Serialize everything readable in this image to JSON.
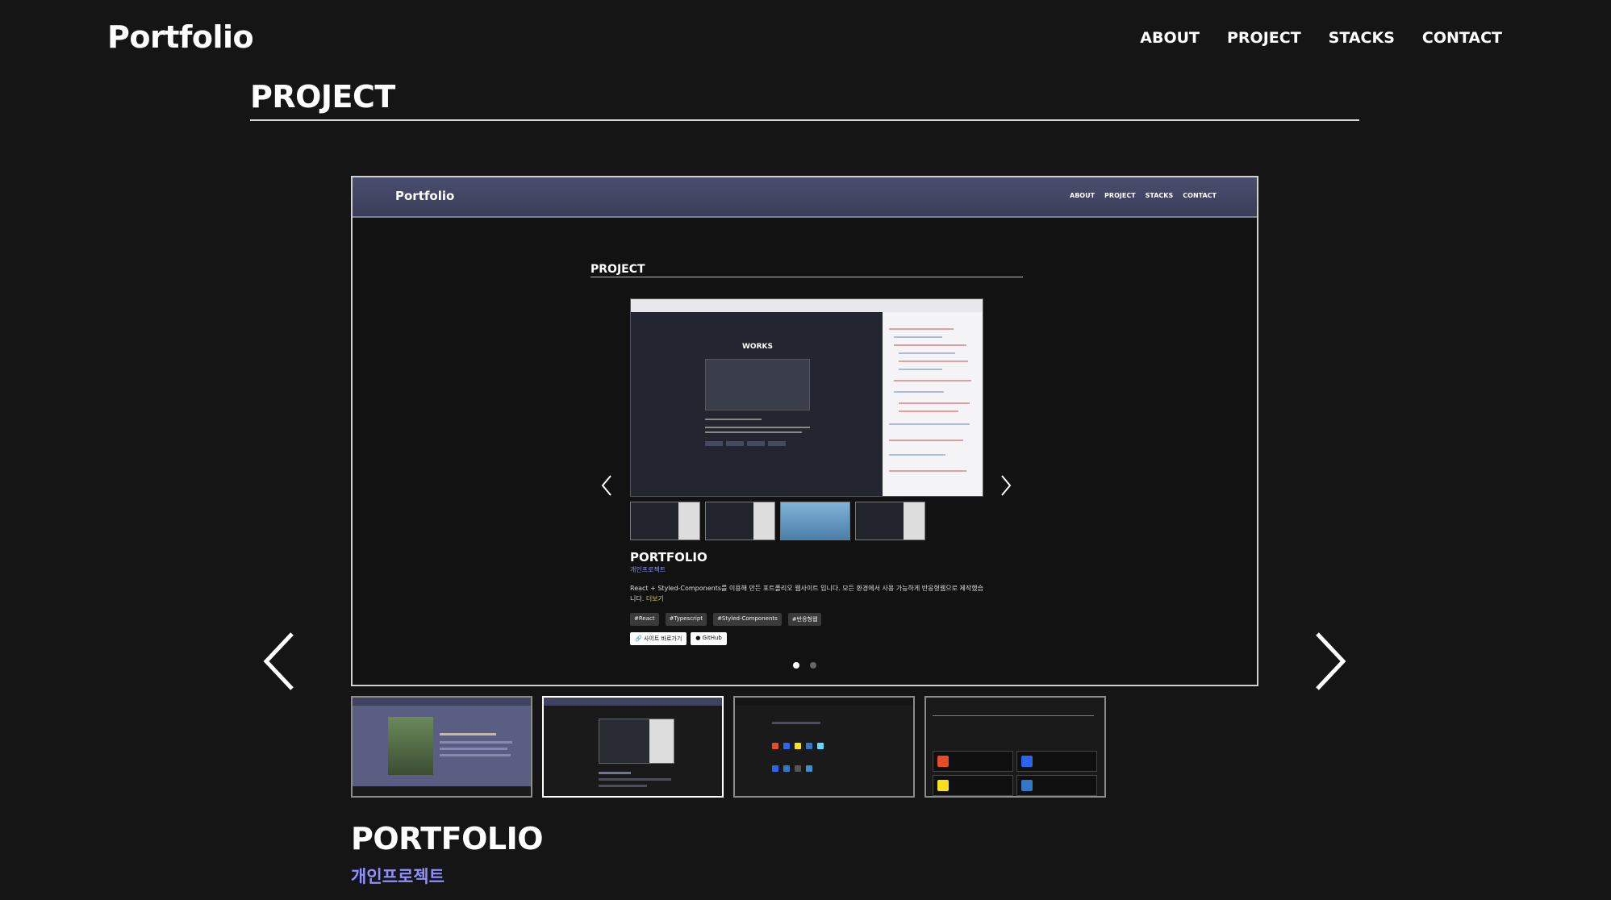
{
  "header": {
    "logo": "Portfolio",
    "nav": [
      "ABOUT",
      "PROJECT",
      "STACKS",
      "CONTACT"
    ]
  },
  "section": {
    "title": "PROJECT"
  },
  "slider": {
    "current_slide": 2,
    "inner": {
      "logo": "Portfolio",
      "nav": [
        "ABOUT",
        "PROJECT",
        "STACKS",
        "CONTACT"
      ],
      "section_title": "PROJECT",
      "works_label": "WORKS",
      "project_title": "PORTFOLIO",
      "project_sub": "개인프로젝트",
      "description": "React + Styled-Components를 이용해 만든 포트폴리오 웹사이트 입니다. 모든 환경에서 사용 가능하게 반응형웹으로 제작했습니다.",
      "more": "더보기",
      "tags": [
        "#React",
        "#Typescript",
        "#Styled-Components",
        "#반응형웹"
      ],
      "buttons": [
        "사이트 바로가기",
        "GitHub"
      ]
    }
  },
  "project": {
    "title": "PORTFOLIO",
    "subtitle": "개인프로젝트"
  },
  "colors": {
    "background": "#151515",
    "accent": "#8f8fff",
    "white": "#ffffff"
  }
}
